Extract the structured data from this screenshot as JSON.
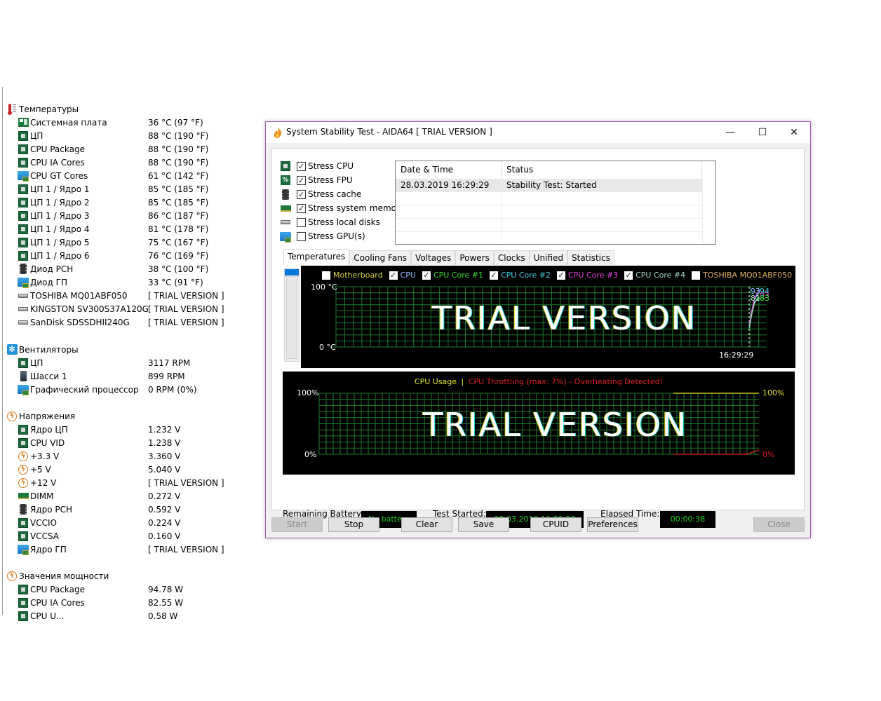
{
  "sensor_panel": {
    "sections": [
      {
        "title": "Температуры",
        "icon": "thermometer-icon",
        "rows": [
          {
            "label": "Системная плата",
            "value": "36 °C  (97 °F)",
            "icon": "motherboard-icon"
          },
          {
            "label": "ЦП",
            "value": "88 °C  (190 °F)",
            "icon": "cpu-chip-icon"
          },
          {
            "label": "CPU Package",
            "value": "88 °C  (190 °F)",
            "icon": "cpu-chip-icon"
          },
          {
            "label": "CPU IA Cores",
            "value": "88 °C  (190 °F)",
            "icon": "cpu-chip-icon"
          },
          {
            "label": "CPU GT Cores",
            "value": "61 °C  (142 °F)",
            "icon": "gpu-icon"
          },
          {
            "label": "ЦП 1 / Ядро 1",
            "value": "85 °C  (185 °F)",
            "icon": "cpu-chip-icon"
          },
          {
            "label": "ЦП 1 / Ядро 2",
            "value": "85 °C  (185 °F)",
            "icon": "cpu-chip-icon"
          },
          {
            "label": "ЦП 1 / Ядро 3",
            "value": "86 °C  (187 °F)",
            "icon": "cpu-chip-icon"
          },
          {
            "label": "ЦП 1 / Ядро 4",
            "value": "81 °C  (178 °F)",
            "icon": "cpu-chip-icon"
          },
          {
            "label": "ЦП 1 / Ядро 5",
            "value": "75 °C  (167 °F)",
            "icon": "cpu-chip-icon"
          },
          {
            "label": "ЦП 1 / Ядро 6",
            "value": "76 °C  (169 °F)",
            "icon": "cpu-chip-icon"
          },
          {
            "label": "Диод PCH",
            "value": "38 °C  (100 °F)",
            "icon": "pch-chip-icon"
          },
          {
            "label": "Диод ГП",
            "value": "33 °C  (91 °F)",
            "icon": "gpu-icon"
          },
          {
            "label": "TOSHIBA MQ01ABF050",
            "value": "[ TRIAL VERSION ]",
            "icon": "disk-icon"
          },
          {
            "label": "KINGSTON SV300S37A120G",
            "value": "[ TRIAL VERSION ]",
            "icon": "disk-icon"
          },
          {
            "label": "SanDisk SDSSDHII240G",
            "value": "[ TRIAL VERSION ]",
            "icon": "disk-icon"
          }
        ]
      },
      {
        "title": "Вентиляторы",
        "icon": "fan-icon",
        "rows": [
          {
            "label": "ЦП",
            "value": "3117 RPM",
            "icon": "cpu-chip-icon"
          },
          {
            "label": "Шасси 1",
            "value": "899 RPM",
            "icon": "case-icon"
          },
          {
            "label": "Графический процессор",
            "value": "0 RPM  (0%)",
            "icon": "gpu-icon"
          }
        ]
      },
      {
        "title": "Напряжения",
        "icon": "voltage-icon",
        "rows": [
          {
            "label": "Ядро ЦП",
            "value": "1.232 V",
            "icon": "cpu-chip-icon"
          },
          {
            "label": "CPU VID",
            "value": "1.238 V",
            "icon": "cpu-chip-icon"
          },
          {
            "label": "+3.3 V",
            "value": "3.360 V",
            "icon": "voltage-icon"
          },
          {
            "label": "+5 V",
            "value": "5.040 V",
            "icon": "voltage-icon"
          },
          {
            "label": "+12 V",
            "value": "[ TRIAL VERSION ]",
            "icon": "voltage-icon"
          },
          {
            "label": "DIMM",
            "value": "0.272 V",
            "icon": "memory-icon"
          },
          {
            "label": "Ядро PCH",
            "value": "0.592 V",
            "icon": "pch-chip-icon"
          },
          {
            "label": "VCCIO",
            "value": "0.224 V",
            "icon": "cpu-chip-icon"
          },
          {
            "label": "VCCSA",
            "value": "0.160 V",
            "icon": "cpu-chip-icon"
          },
          {
            "label": "Ядро ГП",
            "value": "[ TRIAL VERSION ]",
            "icon": "gpu-icon"
          }
        ]
      },
      {
        "title": "Значения мощности",
        "icon": "power-icon",
        "rows": [
          {
            "label": "CPU Package",
            "value": "94.78 W",
            "icon": "cpu-chip-icon"
          },
          {
            "label": "CPU IA Cores",
            "value": "82.55 W",
            "icon": "cpu-chip-icon"
          },
          {
            "label": "CPU U...",
            "value": "0.58 W",
            "icon": "cpu-chip-icon"
          }
        ]
      }
    ]
  },
  "window": {
    "title": "System Stability Test - AIDA64  [ TRIAL VERSION ]",
    "controls": {
      "minimize": "—",
      "maximize": "☐",
      "close": "✕"
    },
    "stress_options": [
      {
        "label": "Stress CPU",
        "checked": true,
        "icon": "cpu-chip-icon"
      },
      {
        "label": "Stress FPU",
        "checked": true,
        "icon": "fpu-icon"
      },
      {
        "label": "Stress cache",
        "checked": true,
        "icon": "cache-chip-icon"
      },
      {
        "label": "Stress system memory",
        "checked": true,
        "icon": "memory-icon"
      },
      {
        "label": "Stress local disks",
        "checked": false,
        "icon": "disk-icon"
      },
      {
        "label": "Stress GPU(s)",
        "checked": false,
        "icon": "gpu-icon"
      }
    ],
    "log": {
      "columns": [
        "Date & Time",
        "Status"
      ],
      "rows": [
        {
          "datetime": "28.03.2019 16:29:29",
          "status": "Stability Test: Started"
        }
      ]
    },
    "tabs": [
      {
        "label": "Temperatures",
        "active": true
      },
      {
        "label": "Cooling Fans",
        "active": false
      },
      {
        "label": "Voltages",
        "active": false
      },
      {
        "label": "Powers",
        "active": false
      },
      {
        "label": "Clocks",
        "active": false
      },
      {
        "label": "Unified",
        "active": false
      },
      {
        "label": "Statistics",
        "active": false
      }
    ],
    "watermark": "TRIAL VERSION",
    "info": {
      "battery_label": "Remaining Battery:",
      "battery_value": "No battery",
      "started_label": "Test Started:",
      "started_value": "28.03.2019 16:29:29",
      "elapsed_label": "Elapsed Time:",
      "elapsed_value": "00:00:38"
    },
    "buttons": [
      {
        "label": "Start",
        "enabled": false
      },
      {
        "label": "Stop",
        "enabled": true
      },
      {
        "label": "Clear",
        "enabled": true
      },
      {
        "label": "Save",
        "enabled": true
      },
      {
        "label": "CPUID",
        "enabled": true
      },
      {
        "label": "Preferences",
        "enabled": true
      },
      {
        "label": "Close",
        "enabled": false
      }
    ],
    "colors": {
      "grid": "#1e7a2e",
      "motherboard": "#d8d834",
      "cpu": "#8ab8ff",
      "core1": "#33dd33",
      "core2": "#44ccdd",
      "core3": "#e040e0",
      "core4": "#a8d8c8",
      "toshiba": "#e0b060",
      "cpu_usage": "#e6e62a",
      "throttle": "#e02020",
      "info_text": "#22cc22"
    }
  },
  "chart_data": [
    {
      "type": "line",
      "title": "Temperatures",
      "ylabel": "°C",
      "ylim": [
        0,
        100
      ],
      "y_tick_labels": [
        "100 °C",
        "0 °C"
      ],
      "x_tick_labels": [
        "16:29:29"
      ],
      "grid": true,
      "legend_placement": "top",
      "legend": [
        {
          "name": "Motherboard",
          "checked": false
        },
        {
          "name": "CPU",
          "checked": true
        },
        {
          "name": "CPU Core #1",
          "checked": true
        },
        {
          "name": "CPU Core #2",
          "checked": true
        },
        {
          "name": "CPU Core #3",
          "checked": true
        },
        {
          "name": "CPU Core #4",
          "checked": true
        },
        {
          "name": "TOSHIBA MQ01ABF050",
          "checked": false
        }
      ],
      "series": [
        {
          "name": "CPU",
          "color_key": "cpu",
          "values": [
            35,
            60,
            80,
            88,
            93
          ]
        },
        {
          "name": "CPU Core #1",
          "color_key": "core1",
          "values": [
            30,
            55,
            72,
            80,
            83
          ]
        },
        {
          "name": "CPU Core #2",
          "color_key": "core2",
          "values": [
            33,
            58,
            78,
            86,
            94
          ]
        },
        {
          "name": "CPU Core #3",
          "color_key": "core3",
          "values": [
            34,
            60,
            80,
            88,
            93
          ]
        },
        {
          "name": "CPU Core #4",
          "color_key": "core4",
          "values": [
            32,
            55,
            74,
            78,
            81
          ]
        }
      ],
      "end_value_labels": [
        {
          "value": "93",
          "color_key": "cpu"
        },
        {
          "value": "94",
          "color_key": "core2"
        },
        {
          "value": "93",
          "color_key": "core3"
        },
        {
          "value": "81",
          "color_key": "core4"
        },
        {
          "value": "83",
          "color_key": "core1"
        }
      ]
    },
    {
      "type": "line",
      "title": "CPU Usage | CPU Throttling (max: 7%) - Overheating Detected!",
      "title_parts": [
        "CPU Usage",
        "|",
        "CPU Throttling (max: 7%) - Overheating Detected!"
      ],
      "ylim": [
        0,
        100
      ],
      "y_tick_labels": [
        "100%",
        "0%"
      ],
      "grid": true,
      "series": [
        {
          "name": "CPU Usage",
          "color_key": "cpu_usage",
          "values": [
            0,
            0,
            0,
            0,
            0,
            0,
            0,
            0,
            0,
            0,
            0,
            0,
            0,
            0,
            0,
            0,
            0,
            0,
            0,
            0,
            0,
            0,
            0,
            0,
            0,
            0,
            2,
            10,
            100,
            100,
            100,
            100,
            100,
            100,
            100,
            100,
            100
          ],
          "end_label": "100%"
        },
        {
          "name": "CPU Throttling",
          "color_key": "throttle",
          "values": [
            0,
            0,
            0,
            0,
            0,
            0,
            0,
            0,
            0,
            0,
            0,
            0,
            0,
            0,
            0,
            0,
            0,
            0,
            0,
            0,
            0,
            0,
            0,
            0,
            0,
            0,
            0,
            0,
            0,
            0,
            0,
            0,
            0,
            0,
            0,
            0,
            7
          ],
          "end_label": "0%"
        }
      ]
    }
  ]
}
